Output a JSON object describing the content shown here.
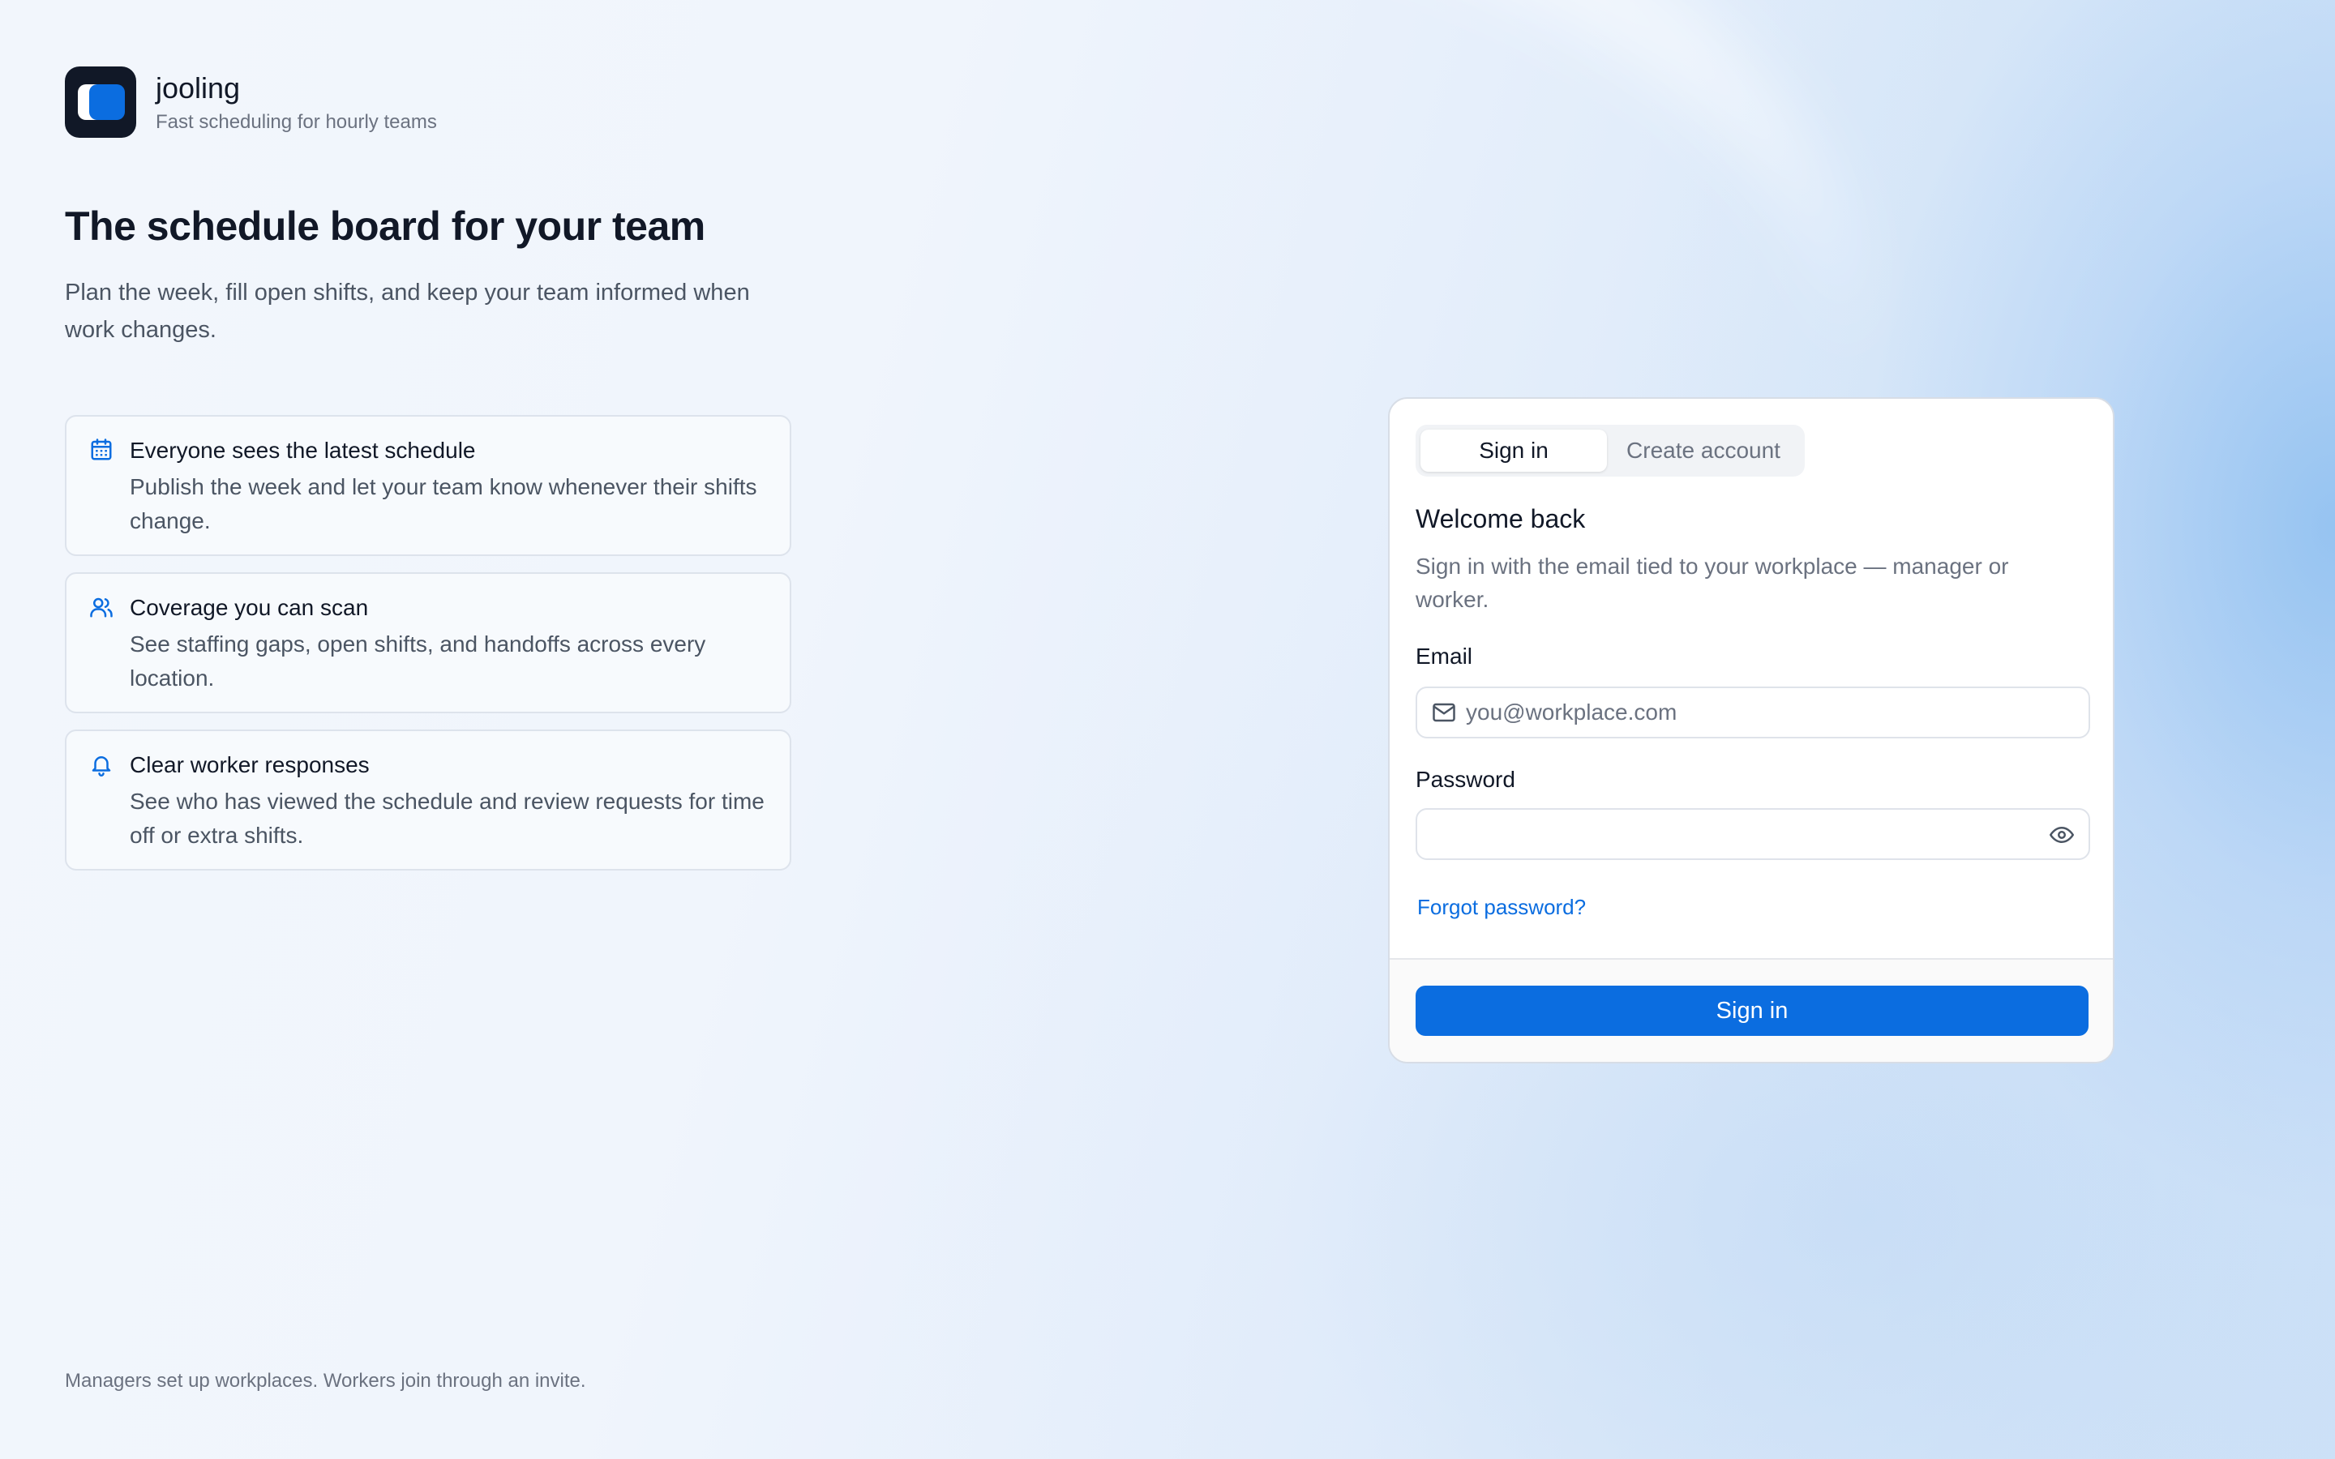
{
  "brand": {
    "name": "jooling",
    "tagline": "Fast scheduling for hourly teams"
  },
  "hero": {
    "title": "The schedule board for your team",
    "subtitle": "Plan the week, fill open shifts, and keep your team informed when work changes."
  },
  "features": [
    {
      "icon": "calendar-icon",
      "title": "Everyone sees the latest schedule",
      "body": "Publish the week and let your team know whenever their shifts change."
    },
    {
      "icon": "users-icon",
      "title": "Coverage you can scan",
      "body": "See staffing gaps, open shifts, and handoffs across every location."
    },
    {
      "icon": "bell-icon",
      "title": "Clear worker responses",
      "body": "See who has viewed the schedule and review requests for time off or extra shifts."
    }
  ],
  "footer_note": "Managers set up workplaces. Workers join through an invite.",
  "auth": {
    "tabs": [
      "Sign in",
      "Create account"
    ],
    "active_tab": "Sign in",
    "heading": "Welcome back",
    "subheading": "Sign in with the email tied to your workplace — manager or worker.",
    "email_label": "Email",
    "email_placeholder": "you@workplace.com",
    "email_value": "",
    "password_label": "Password",
    "password_value": "",
    "forgot_label": "Forgot password?",
    "submit_label": "Sign in"
  },
  "colors": {
    "accent": "#0b6de0",
    "text": "#111827",
    "muted": "#6b7280"
  }
}
